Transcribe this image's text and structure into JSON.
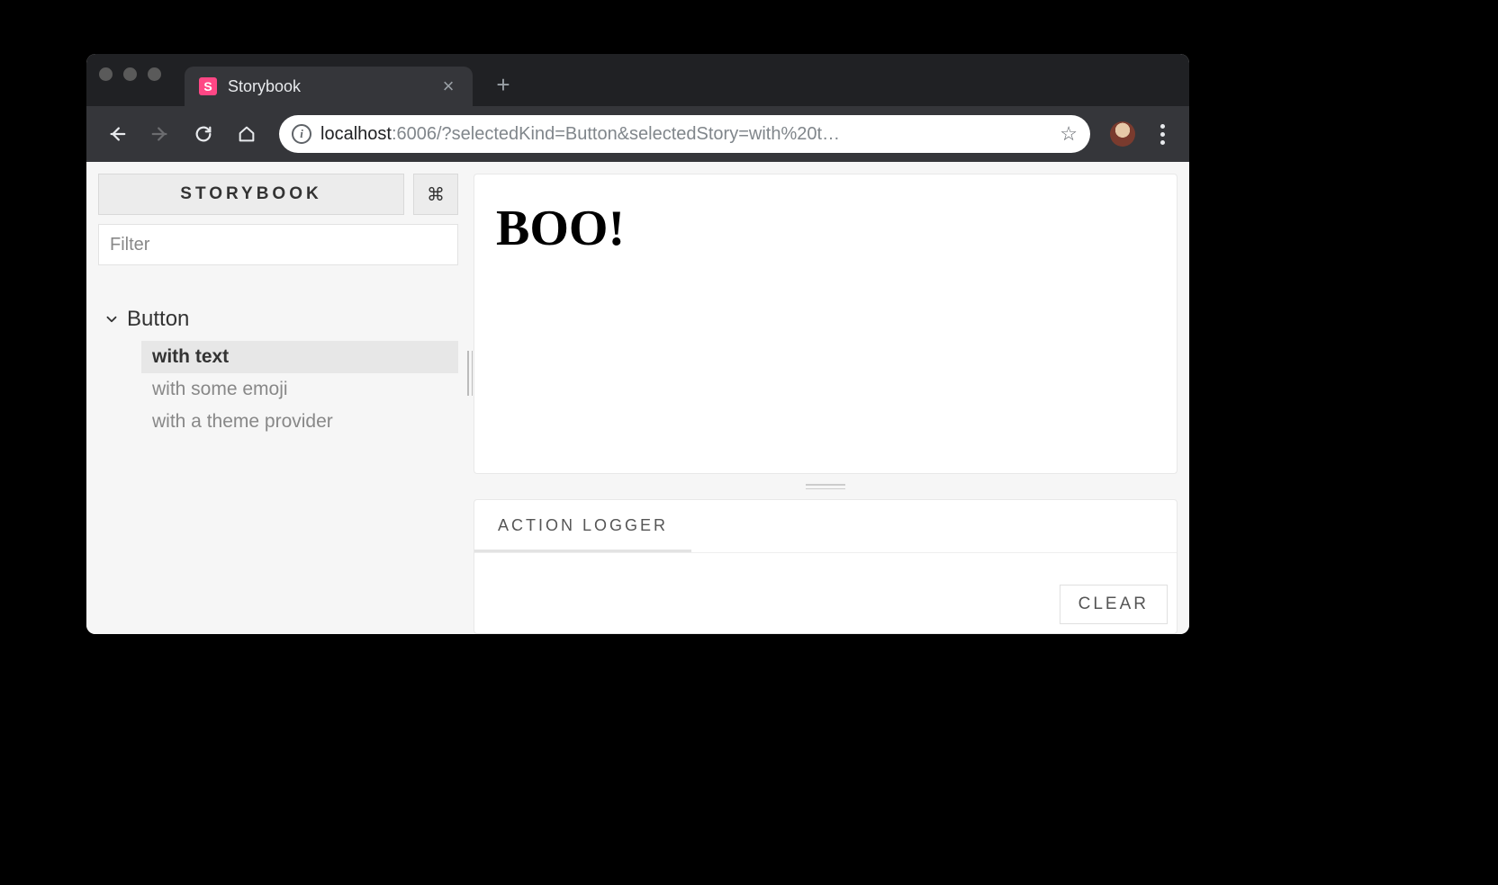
{
  "browser": {
    "tab_title": "Storybook",
    "favicon_letter": "S",
    "url_host": "localhost",
    "url_rest": ":6006/?selectedKind=Button&selectedStory=with%20t…"
  },
  "sidebar": {
    "title": "STORYBOOK",
    "shortcut_glyph": "⌘",
    "filter_placeholder": "Filter",
    "kind": "Button",
    "stories": [
      {
        "label": "with text",
        "selected": true
      },
      {
        "label": "with some emoji",
        "selected": false
      },
      {
        "label": "with a theme provider",
        "selected": false
      }
    ]
  },
  "preview": {
    "heading": "BOO!"
  },
  "panel": {
    "tab_label": "ACTION LOGGER",
    "clear_label": "CLEAR"
  }
}
